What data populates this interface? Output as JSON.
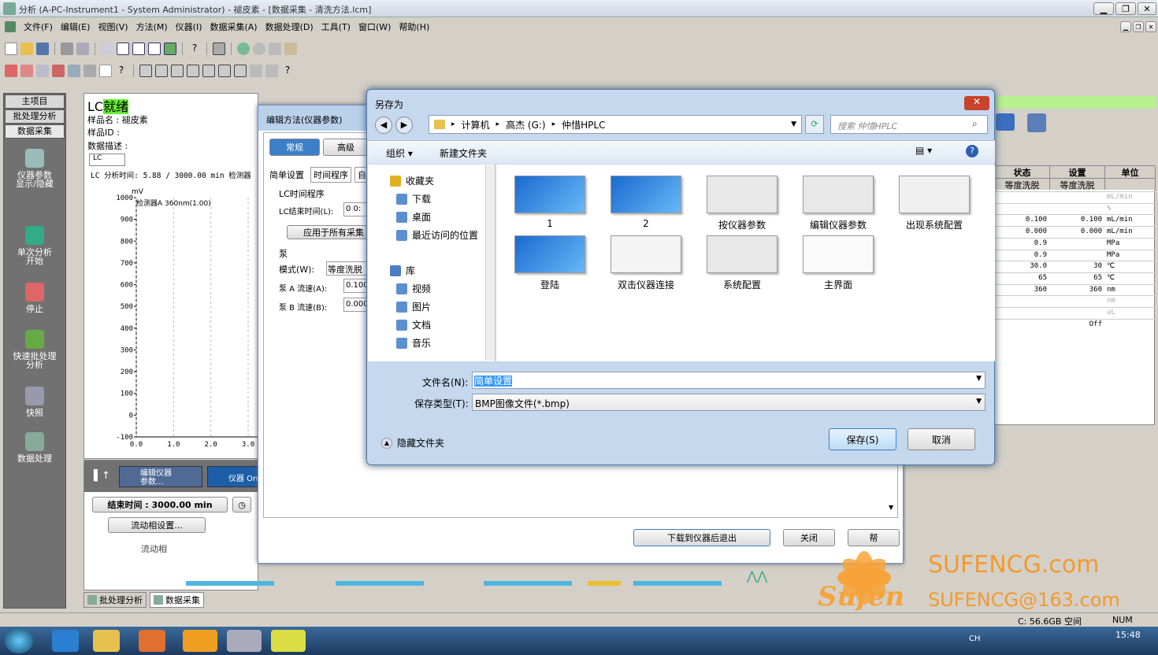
{
  "window": {
    "title": "分析 (A-PC-Instrument1 - System Administrator) - 褪皮素 - [数据采集 - 清洗方法.lcm]"
  },
  "menu": [
    "文件(F)",
    "编辑(E)",
    "视图(V)",
    "方法(M)",
    "仪器(I)",
    "数据采集(A)",
    "数据处理(D)",
    "工具(T)",
    "窗口(W)",
    "帮助(H)"
  ],
  "sidebar": {
    "tabs": [
      "主项目",
      "批处理分析",
      "数据采集"
    ],
    "items": [
      "仪器参数\n显示/隐藏",
      "单次分析\n开始",
      "停止",
      "快速批处理\n分析",
      "快照",
      "数据处理"
    ]
  },
  "lc_panel": {
    "status_prefix": "LC",
    "status": "就绪",
    "sample_name_label": "样品名 :",
    "sample_name": "褪皮素",
    "sample_id_label": "样品ID :",
    "data_desc_label": "数据描述 :",
    "lc_tab": "LC",
    "analysis_time": "LC 分析时间: 5.88 / 3000.00 min 检测器",
    "chart_unit": "mV",
    "detector_label": "检测器A 360nm(1.00)"
  },
  "chart_data": {
    "type": "line",
    "ylabel": "mV",
    "yticks": [
      "1000",
      "900",
      "800",
      "700",
      "600",
      "500",
      "400",
      "300",
      "200",
      "100",
      "0",
      "-100"
    ],
    "xticks": [
      "0.0",
      "1.0",
      "2.0",
      "3.0"
    ],
    "ylim": [
      -100,
      1000
    ],
    "xlim": [
      0,
      3
    ],
    "series": []
  },
  "bottom_panel": {
    "btn_edit_params": "编辑仪器\n参数...",
    "btn_instrument_on": "仪器 On",
    "end_time": "结束时间 : 3000.00 min",
    "flow_path_settings": "流动相设置...",
    "flow_phase": "流动相"
  },
  "bottom_tabs": [
    "批处理分析",
    "数据采集"
  ],
  "edit_method": {
    "title": "编辑方法(仪器参数)",
    "tabs": [
      "常规",
      "高级"
    ],
    "subtabs": [
      "简单设置",
      "时间程序",
      "自"
    ],
    "lc_time_program": "LC时间程序",
    "lc_end_time_label": "LC结束时间(L):",
    "lc_end_time_value": "0 0:",
    "apply_all": "应用于所有采集",
    "pump_label": "泵",
    "mode_label": "模式(W):",
    "mode_value": "等度洗脱",
    "pump_a_label": "泵 A 流速(A):",
    "pump_a_value": "0.100",
    "pump_b_label": "泵 B 流速(B):",
    "pump_b_value": "0.000",
    "download_exit": "下载到仪器后退出",
    "close": "关闭",
    "help": "帮"
  },
  "right_table": {
    "headers": [
      "状态",
      "设置",
      "单位"
    ],
    "row0": [
      "等度洗脱",
      "等度洗脱",
      ""
    ],
    "rows": [
      [
        "",
        "",
        "mL/min"
      ],
      [
        "",
        "",
        "%"
      ],
      [
        "0.100",
        "0.100",
        "mL/min"
      ],
      [
        "0.000",
        "0.000",
        "mL/min"
      ],
      [
        "0.9",
        "",
        "MPa"
      ],
      [
        "0.9",
        "",
        "MPa"
      ],
      [
        "30.0",
        "30",
        "℃"
      ],
      [
        "65",
        "65",
        "℃"
      ],
      [
        "360",
        "360",
        "nm"
      ],
      [
        "",
        "",
        "nm"
      ],
      [
        "",
        "",
        "uL"
      ],
      [
        "",
        "Off",
        ""
      ]
    ]
  },
  "save_dialog": {
    "title": "另存为",
    "breadcrumb": [
      "计算机",
      "高杰 (G:)",
      "仲惜HPLC"
    ],
    "search_placeholder": "搜索 仲惜HPLC",
    "organize": "组织 ▾",
    "new_folder": "新建文件夹",
    "nav_groups": [
      {
        "label": "收藏夹",
        "items": [
          "下载",
          "桌面",
          "最近访问的位置"
        ]
      },
      {
        "label": "库",
        "items": [
          "视频",
          "图片",
          "文档",
          "音乐"
        ]
      }
    ],
    "files": [
      "1",
      "2",
      "按仪器参数",
      "编辑仪器参数",
      "出现系统配置",
      "登陆",
      "双击仪器连接",
      "系统配置",
      "主界面"
    ],
    "filename_label": "文件名(N):",
    "filename": "简单设置",
    "filetype_label": "保存类型(T):",
    "filetype": "BMP图像文件(*.bmp)",
    "hide_folders": "隐藏文件夹",
    "save": "保存(S)",
    "cancel": "取消"
  },
  "status_bar": {
    "disk": "C: 56.6GB 空间",
    "num": "NUM"
  },
  "taskbar": {
    "ime": "CH",
    "time": "15:48"
  },
  "watermark": {
    "site": "SUFENCG.com",
    "email": "SUFENCG@163.com",
    "brand": "Sufen"
  },
  "colors": {
    "ready_bg": "#66ee33",
    "dialog_blue": "#b9d1ea",
    "taskbar": "#1d3a5f"
  }
}
